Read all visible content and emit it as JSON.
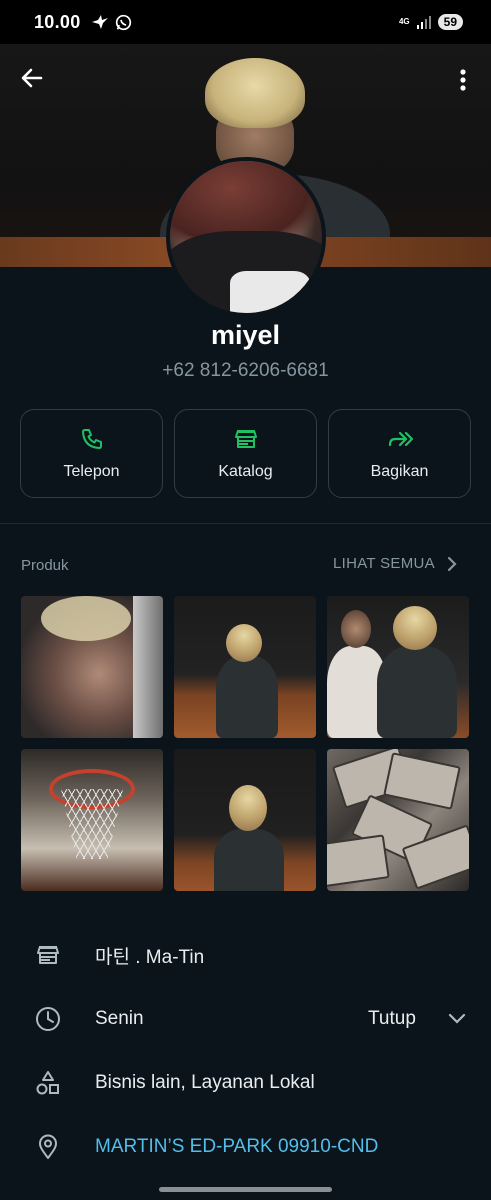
{
  "status_bar": {
    "time": "10.00",
    "network": "4G",
    "battery": "59"
  },
  "profile": {
    "name": "miyel",
    "phone": "+62 812-6206-6681"
  },
  "actions": [
    {
      "label": "Telepon",
      "icon": "phone-icon"
    },
    {
      "label": "Katalog",
      "icon": "store-icon"
    },
    {
      "label": "Bagikan",
      "icon": "share-forward-icon"
    }
  ],
  "products": {
    "title": "Produk",
    "see_all": "LIHAT SEMUA"
  },
  "info": {
    "business_name": "마틴 . Ma-Tin",
    "hours_day": "Senin",
    "hours_status": "Tutup",
    "category": "Bisnis lain, Layanan Lokal",
    "address": "MARTIN’S ED-PARK 09910-CND"
  },
  "colors": {
    "background": "#0b141a",
    "accent_green": "#21c063",
    "link_blue": "#53bdeb",
    "muted_text": "#8696a0"
  }
}
